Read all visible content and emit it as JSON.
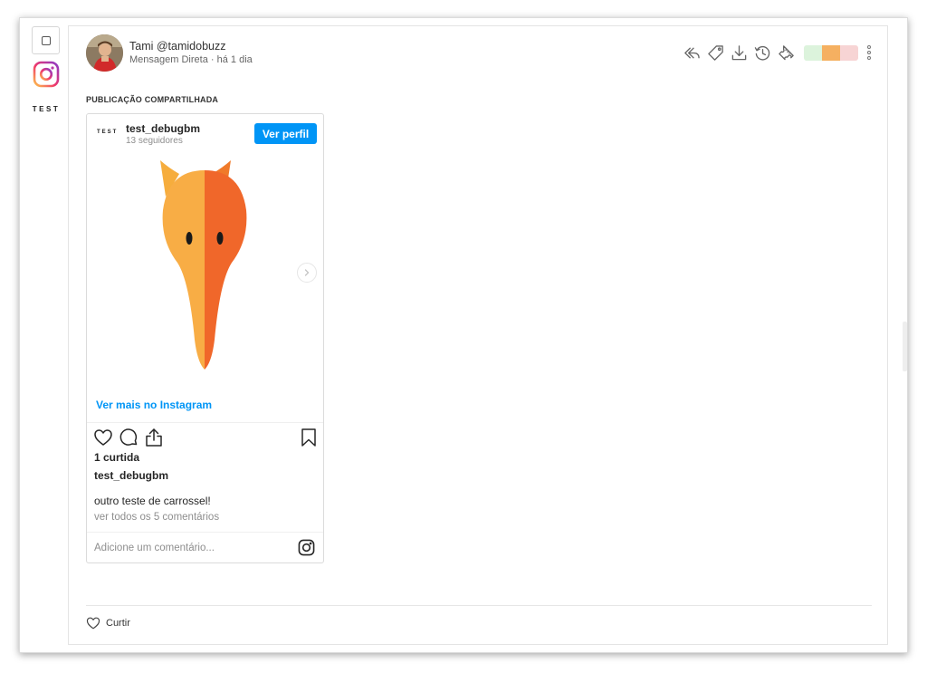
{
  "rail": {
    "brand_label": "TEST"
  },
  "message": {
    "sender": "Tami @tamidobuzz",
    "channel": "Mensagem Direta",
    "separator": "·",
    "time": "há 1 dia",
    "section_title": "PUBLICAÇÃO COMPARTILHADA"
  },
  "toolbar": {
    "icons": [
      "reply-icon",
      "tag-icon",
      "download-icon",
      "history-icon",
      "ticket-icon",
      "more-icon"
    ],
    "swatch_colors": [
      "#dcf3dc",
      "#f5b061",
      "#f7d4d4"
    ]
  },
  "post": {
    "account_badge": "TEST",
    "account_name": "test_debugbm",
    "followers": "13 seguidores",
    "view_profile_label": "Ver perfil",
    "see_more_label": "Ver mais no Instagram",
    "likes": "1 curtida",
    "username": "test_debugbm",
    "caption": "outro teste de carrossel!",
    "comments_link": "ver todos os 5 comentários",
    "comment_placeholder": "Adicione um comentário...",
    "accent_color": "#0095f6"
  },
  "footer": {
    "like_label": "Curtir"
  }
}
